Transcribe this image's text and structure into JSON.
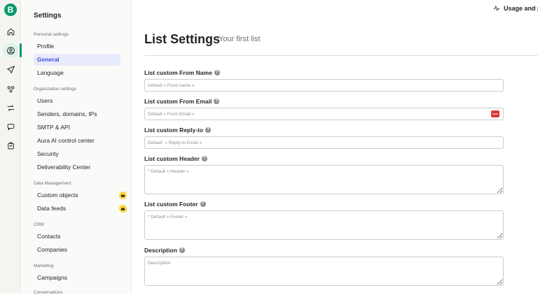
{
  "app": {
    "logo_letter": "B",
    "accent": "#0b996e"
  },
  "rail": {
    "icons": [
      "home-icon",
      "contacts-icon",
      "campaigns-icon",
      "automations-icon",
      "transactional-icon",
      "conversations-icon",
      "sales-icon"
    ]
  },
  "sidenav": {
    "title": "Settings",
    "groups": {
      "personal": "Personal settings",
      "organization": "Organization settings",
      "data": "Data Management",
      "crm": "CRM",
      "marketing": "Marketing",
      "conversations": "Conversations"
    },
    "items": {
      "profile": "Profile",
      "general": "General",
      "language": "Language",
      "users": "Users",
      "senders": "Senders, domains, IPs",
      "smtp": "SMTP & API",
      "aura": "Aura AI control center",
      "security": "Security",
      "deliverability": "Deliverability Center",
      "custom_objects": "Custom objects",
      "data_feeds": "Data feeds",
      "contacts": "Contacts",
      "companies": "Companies",
      "campaigns": "Campaigns"
    }
  },
  "header": {
    "usage_label": "Usage and p"
  },
  "main": {
    "title": "List Settings",
    "subtitle": "Your first list",
    "fields": {
      "from_name": {
        "label": "List custom From Name",
        "placeholder": "Default « From name »"
      },
      "from_email": {
        "label": "List custom From Email",
        "placeholder": "Default « From Email »"
      },
      "reply_to": {
        "label": "List custom Reply-to",
        "placeholder": "Default  « Reply-to Email »"
      },
      "header": {
        "label": "List custom Header",
        "placeholder": "* Default « Header »"
      },
      "footer": {
        "label": "List custom Footer",
        "placeholder": "* Default « Footer »"
      },
      "description": {
        "label": "Description",
        "placeholder": "Description"
      }
    },
    "help_glyph": "?"
  }
}
